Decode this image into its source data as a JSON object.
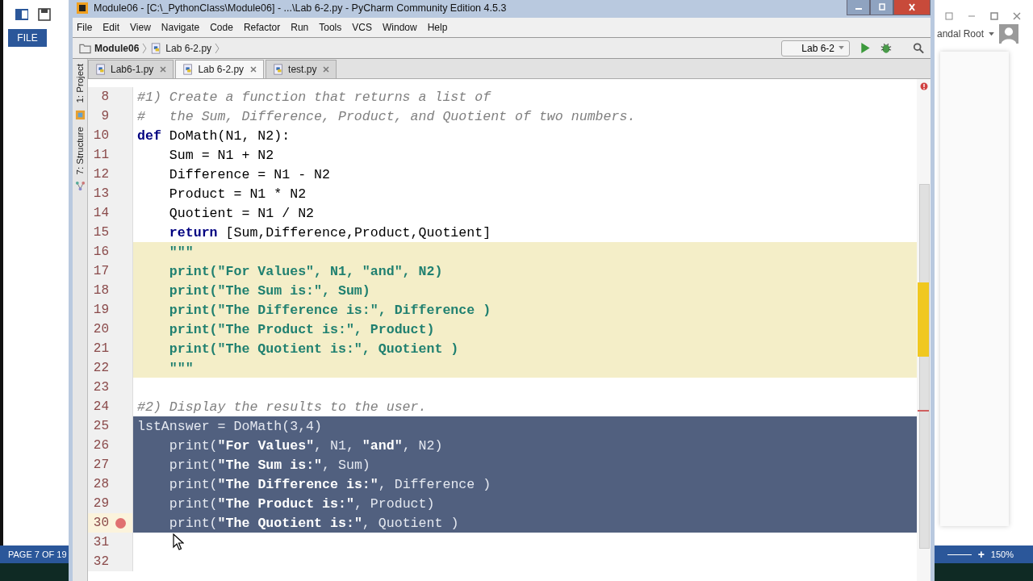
{
  "word": {
    "file_tab": "FILE",
    "user": "andal Root",
    "status": "PAGE 7 OF 19",
    "zoom_plus": "+",
    "zoom": "150%"
  },
  "window": {
    "title": "Module06 - [C:\\_PythonClass\\Module06] - ...\\Lab 6-2.py - PyCharm Community Edition 4.5.3"
  },
  "menu": [
    "File",
    "Edit",
    "View",
    "Navigate",
    "Code",
    "Refactor",
    "Run",
    "Tools",
    "VCS",
    "Window",
    "Help"
  ],
  "breadcrumb": [
    {
      "label": "Module06",
      "kind": "folder"
    },
    {
      "label": "Lab 6-2.py",
      "kind": "file"
    }
  ],
  "run_config": "Lab 6-2",
  "tabs": [
    {
      "label": "Lab6-1.py",
      "selected": false
    },
    {
      "label": "Lab 6-2.py",
      "selected": true
    },
    {
      "label": "test.py",
      "selected": false
    }
  ],
  "tool_windows": [
    "1: Project",
    "7: Structure"
  ],
  "lines": [
    {
      "number": "8",
      "kind": "plain",
      "breakpoint": false,
      "segments": [
        {
          "text": "#1) Create a function that returns a list of",
          "kind": "comment"
        }
      ]
    },
    {
      "number": "9",
      "kind": "plain",
      "breakpoint": false,
      "segments": [
        {
          "text": "#   the Sum, Difference, Product, and Quotient of two numbers.",
          "kind": "comment"
        }
      ]
    },
    {
      "number": "10",
      "kind": "plain",
      "breakpoint": false,
      "segments": [
        {
          "text": "def",
          "kind": "keyword"
        },
        {
          "text": " DoMath(N1, N2):",
          "kind": "text"
        }
      ]
    },
    {
      "number": "11",
      "kind": "plain",
      "breakpoint": false,
      "segments": [
        {
          "text": "    Sum = N1 + N2",
          "kind": "text"
        }
      ]
    },
    {
      "number": "12",
      "kind": "plain",
      "breakpoint": false,
      "segments": [
        {
          "text": "    Difference = N1 - N2",
          "kind": "text"
        }
      ]
    },
    {
      "number": "13",
      "kind": "plain",
      "breakpoint": false,
      "segments": [
        {
          "text": "    Product = N1 * N2",
          "kind": "text"
        }
      ]
    },
    {
      "number": "14",
      "kind": "plain",
      "breakpoint": false,
      "segments": [
        {
          "text": "    Quotient = N1 / N2",
          "kind": "text"
        }
      ]
    },
    {
      "number": "15",
      "kind": "plain",
      "breakpoint": false,
      "segments": [
        {
          "text": "    return",
          "kind": "keyword"
        },
        {
          "text": " [Sum,Difference,Product,Quotient]",
          "kind": "text"
        }
      ]
    },
    {
      "number": "16",
      "kind": "docstring",
      "breakpoint": false,
      "segments": [
        {
          "text": "    \"\"\"",
          "kind": "string"
        }
      ]
    },
    {
      "number": "17",
      "kind": "docstring",
      "breakpoint": false,
      "segments": [
        {
          "text": "    print(\"For Values\", N1, \"and\", N2)",
          "kind": "string"
        }
      ]
    },
    {
      "number": "18",
      "kind": "docstring",
      "breakpoint": false,
      "segments": [
        {
          "text": "    print(\"The Sum is:\", Sum)",
          "kind": "string"
        }
      ]
    },
    {
      "number": "19",
      "kind": "docstring",
      "breakpoint": false,
      "segments": [
        {
          "text": "    print(\"The Difference is:\", Difference )",
          "kind": "string"
        }
      ]
    },
    {
      "number": "20",
      "kind": "docstring",
      "breakpoint": false,
      "segments": [
        {
          "text": "    print(\"The Product is:\", Product)",
          "kind": "string"
        }
      ]
    },
    {
      "number": "21",
      "kind": "docstring",
      "breakpoint": false,
      "segments": [
        {
          "text": "    print(\"The Quotient is:\", Quotient )",
          "kind": "string"
        }
      ]
    },
    {
      "number": "22",
      "kind": "docstring",
      "breakpoint": false,
      "segments": [
        {
          "text": "    \"\"\"",
          "kind": "string"
        }
      ]
    },
    {
      "number": "23",
      "kind": "plain",
      "breakpoint": false
    },
    {
      "number": "24",
      "kind": "plain",
      "breakpoint": false,
      "segments": [
        {
          "text": "#2) Display the results to the user.",
          "kind": "comment"
        }
      ]
    },
    {
      "number": "25",
      "kind": "selected",
      "breakpoint": false,
      "segments": [
        {
          "text": "lstAnswer = DoMath(3,4)",
          "kind": "text"
        }
      ]
    },
    {
      "number": "26",
      "kind": "selected",
      "breakpoint": false,
      "segments": [
        {
          "text": "    print(",
          "kind": "text"
        },
        {
          "text": "\"For Values\"",
          "kind": "string"
        },
        {
          "text": ", N1, ",
          "kind": "text"
        },
        {
          "text": "\"and\"",
          "kind": "string"
        },
        {
          "text": ", N2)",
          "kind": "text"
        }
      ]
    },
    {
      "number": "27",
      "kind": "selected",
      "breakpoint": false,
      "segments": [
        {
          "text": "    print(",
          "kind": "text"
        },
        {
          "text": "\"The Sum is:\"",
          "kind": "string"
        },
        {
          "text": ", Sum)",
          "kind": "text"
        }
      ]
    },
    {
      "number": "28",
      "kind": "selected",
      "breakpoint": false,
      "segments": [
        {
          "text": "    print(",
          "kind": "text"
        },
        {
          "text": "\"The Difference is:\"",
          "kind": "string"
        },
        {
          "text": ", Difference )",
          "kind": "text"
        }
      ]
    },
    {
      "number": "29",
      "kind": "selected",
      "breakpoint": false,
      "segments": [
        {
          "text": "    print(",
          "kind": "text"
        },
        {
          "text": "\"The Product is:\"",
          "kind": "string"
        },
        {
          "text": ", Product)",
          "kind": "text"
        }
      ]
    },
    {
      "number": "30",
      "kind": "selected",
      "breakpoint": true,
      "segments": [
        {
          "text": "    print(",
          "kind": "text"
        },
        {
          "text": "\"The Quotient is:\"",
          "kind": "string"
        },
        {
          "text": ", Quotient )",
          "kind": "text"
        }
      ]
    },
    {
      "number": "31",
      "kind": "plain",
      "breakpoint": false
    },
    {
      "number": "32",
      "kind": "plain",
      "breakpoint": false
    }
  ]
}
